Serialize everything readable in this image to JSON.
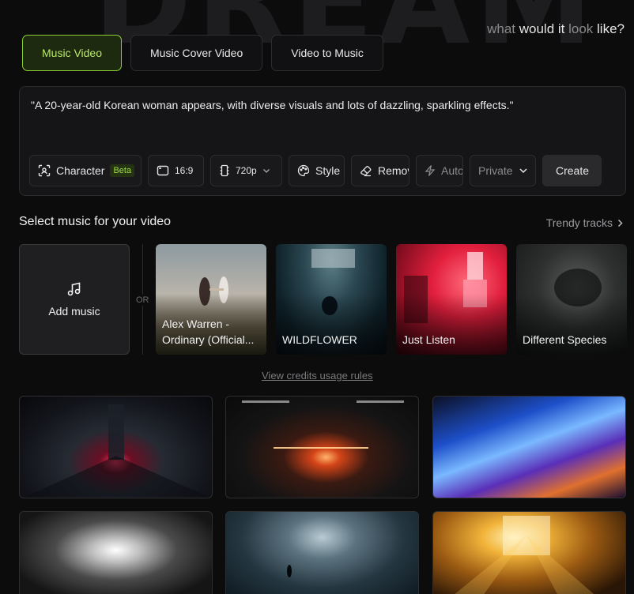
{
  "hero": {
    "bg_word": "DREAM",
    "tagline_pre": "what ",
    "tagline_hl1": "would it",
    "tagline_mid": " look ",
    "tagline_hl2": "like?"
  },
  "tabs": [
    {
      "label": "Music Video",
      "active": true
    },
    {
      "label": "Music Cover Video",
      "active": false
    },
    {
      "label": "Video to Music",
      "active": false
    }
  ],
  "prompt": {
    "text": "\"A 20-year-old Korean woman appears, with diverse visuals and lots of dazzling, sparkling effects.\""
  },
  "toolbar": {
    "character_label": "Character",
    "beta_badge": "Beta",
    "aspect_label": "16:9",
    "resolution_label": "720p",
    "style_label": "Style",
    "remove_label": "Remov",
    "auto_label": "Auto",
    "privacy_label": "Private",
    "create_label": "Create"
  },
  "music": {
    "section_title": "Select music for your video",
    "trendy_label": "Trendy tracks",
    "add_music_label": "Add music",
    "or_label": "OR",
    "tracks": [
      {
        "title": "Alex Warren -\nOrdinary (Official..."
      },
      {
        "title": "WILDFLOWER"
      },
      {
        "title": "Just Listen"
      },
      {
        "title": "Different Species"
      }
    ],
    "credits_link": "View credits usage rules"
  },
  "icons": {
    "character": "face-scan-icon",
    "aspect": "aspect-ratio-icon",
    "resolution": "film-icon",
    "style": "palette-icon",
    "remove": "eraser-icon",
    "auto": "lightning-icon",
    "privacy_chevron": "chevron-down-icon",
    "trendy_chevron": "chevron-right-icon",
    "add_music": "music-note-icon"
  },
  "colors": {
    "accent": "#8ccf35",
    "background": "#0c0c0d"
  }
}
